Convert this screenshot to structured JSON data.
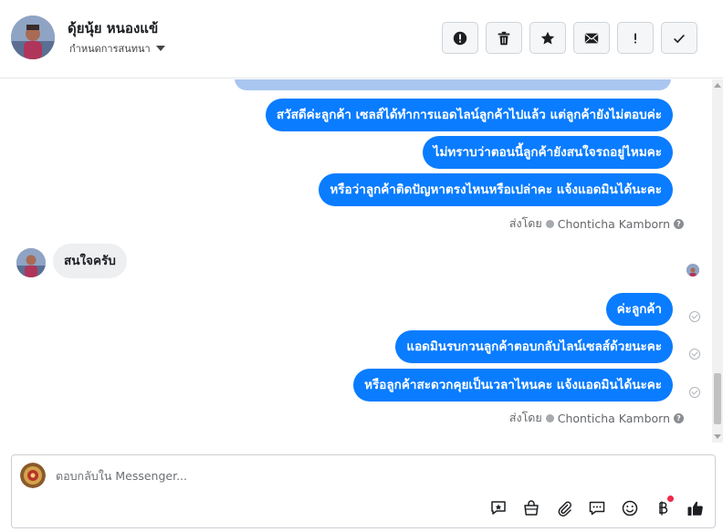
{
  "header": {
    "contact_name": "ดุ้ยนุ้ย หนองแข้",
    "assign_label": "กำหนดการสนทนา",
    "actions": [
      {
        "name": "spam-button",
        "icon": "alert-circle-icon"
      },
      {
        "name": "delete-button",
        "icon": "trash-icon"
      },
      {
        "name": "star-button",
        "icon": "star-icon"
      },
      {
        "name": "mark-unread-button",
        "icon": "envelope-icon"
      },
      {
        "name": "follow-up-button",
        "icon": "exclamation-icon"
      },
      {
        "name": "mark-done-button",
        "icon": "check-icon"
      }
    ]
  },
  "thread": {
    "outgoing_group_1": [
      "สวัสดีค่ะลูกค้า เซลส์ได้ทำการแอดไลน์ลูกค้าไปแล้ว แต่ลูกค้ายังไม่ตอบค่ะ",
      "ไม่ทราบว่าตอนนี้ลูกค้ายังสนใจรถอยู่ไหมคะ",
      "หรือว่าลูกค้าติดปัญหาตรงไหนหรือเปล่าคะ แจ้งแอดมินได้นะคะ"
    ],
    "sent_by_1": {
      "prefix": "ส่งโดย",
      "name": "Chonticha Kamborn"
    },
    "incoming_message": "สนใจครับ",
    "outgoing_group_2": [
      "ค่ะลูกค้า",
      "แอดมินรบกวนลูกค้าตอบกลับไลน์เซลส์ด้วยนะคะ",
      "หรือลูกค้าสะดวกคุยเป็นเวลาไหนคะ แจ้งแอดมินได้นะคะ"
    ],
    "sent_by_2": {
      "prefix": "ส่งโดย",
      "name": "Chonticha Kamborn"
    }
  },
  "composer": {
    "placeholder": "ตอบกลับใน Messenger...",
    "tools": [
      "saved-reply-icon",
      "shop-bag-icon",
      "paperclip-icon",
      "chat-bubbles-icon",
      "emoji-icon",
      "baht-icon",
      "thumbs-up-icon"
    ]
  },
  "colors": {
    "outgoing_bubble": "#0a7cff",
    "incoming_bubble": "#eeeff1",
    "notification_dot": "#f02849"
  }
}
